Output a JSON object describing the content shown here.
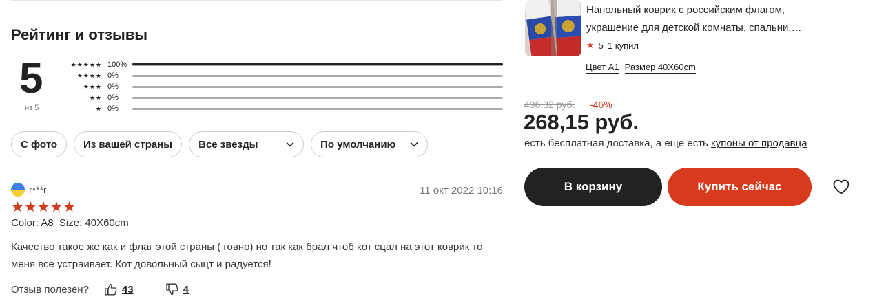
{
  "reviews_section": {
    "title": "Рейтинг и отзывы",
    "score": "5",
    "score_sub": "из 5",
    "distribution": [
      {
        "stars": "★★★★★",
        "pct_label": "100%",
        "fraction": 1.0
      },
      {
        "stars": "★★★★",
        "pct_label": "0%",
        "fraction": 0
      },
      {
        "stars": "★★★",
        "pct_label": "0%",
        "fraction": 0
      },
      {
        "stars": "★★",
        "pct_label": "0%",
        "fraction": 0
      },
      {
        "stars": "★",
        "pct_label": "0%",
        "fraction": 0
      }
    ],
    "filters": {
      "with_photo": "С фото",
      "your_country": "Из вашей страны",
      "all_stars": "Все звезды",
      "sort_default": "По умолчанию"
    }
  },
  "review": {
    "name": "r***r",
    "date": "11 окт 2022 10:16",
    "stars": "★★★★★",
    "color_label": "Color: A8",
    "size_label": "Size: 40X60cm",
    "text": "Качество такое же как и флаг этой страны ( говно) но так как брал чтоб кот сцал на этот коврик то меня все устраивает. Кот довольный сыцт и радуется!",
    "helpful_label": "Отзыв полезен?",
    "likes": "43",
    "dislikes": "4"
  },
  "product": {
    "title": "Напольный коврик с российским флагом, украшение для детской комнаты, спальни,…",
    "rating": "5",
    "bought": "1 купил",
    "variant_color": "Цвет A1",
    "variant_size": "Размер 40X60cm",
    "old_price": "496,32 руб.",
    "discount": "-46%",
    "price": "268,15 руб.",
    "delivery_text": "есть бесплатная доставка, а еще есть ",
    "coupons_link": "купоны от продавца",
    "cart_button": "В корзину",
    "buy_button": "Купить сейчас"
  },
  "colors": {
    "accent_red": "#d73a1c",
    "dark_button": "#222222",
    "star_red": "#d33a1f"
  }
}
